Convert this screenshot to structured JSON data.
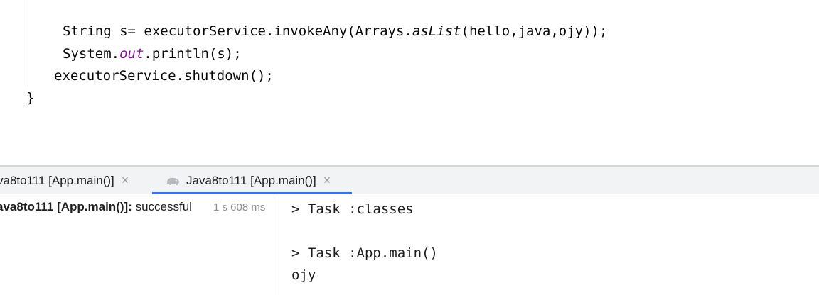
{
  "editor": {
    "line1": {
      "pre": "String s= executorService.invokeAny(Arrays.",
      "method": "asList",
      "post": "(hello,java,ojy));"
    },
    "line2": {
      "pre": "System.",
      "field": "out",
      "post": ".println(s);"
    },
    "line3": "executorService.shutdown();",
    "line4": "}"
  },
  "run_panel": {
    "tabs": [
      {
        "label": "va8to111 [App.main()]",
        "close": "×"
      },
      {
        "label": "Java8to111 [App.main()]",
        "close": "×",
        "icon": "gradle-elephant-icon"
      }
    ],
    "tree": {
      "node": "ava8to111 [App.main()]:",
      "status": "successful",
      "duration": "1 s 608 ms"
    },
    "console": [
      "> Task :classes",
      "",
      "> Task :App.main()",
      "ojy"
    ]
  },
  "colors": {
    "accent": "#3574f0",
    "keyword_field": "#871094",
    "tab_bar_bg": "#f2f3f5"
  }
}
